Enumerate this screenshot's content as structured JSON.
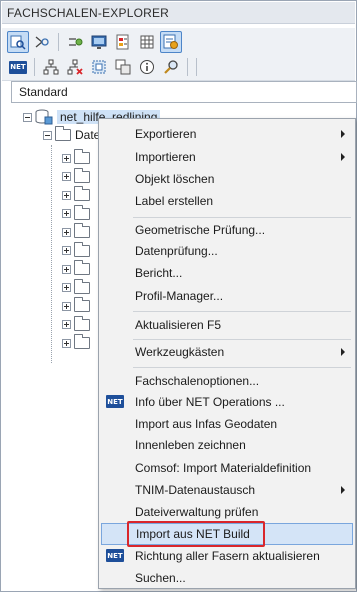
{
  "panel": {
    "title": "FACHSCHALEN-EXPLORER"
  },
  "toolbar": {
    "row1": [
      "display-icon",
      "navigate-icon",
      "settings-icon",
      "monitor-icon",
      "properties-icon",
      "grid-icon",
      "explorer-icon"
    ],
    "row2_badge": "NET",
    "row2": [
      "hierarchy-icon",
      "hierarchy-delete-icon",
      "select-icon",
      "copy-icon",
      "info-icon",
      "search-icon"
    ]
  },
  "filter": {
    "value": "Standard"
  },
  "tree": {
    "root": "net_hilfe_redlining",
    "child": "Date",
    "folder_rows": 11
  },
  "context_menu": {
    "items": [
      {
        "label": "Exportieren",
        "submenu": true
      },
      {
        "label": "Importieren",
        "submenu": true
      },
      {
        "label": "Objekt löschen"
      },
      {
        "label": "Label erstellen"
      },
      {
        "label": "Geometrische Prüfung..."
      },
      {
        "label": "Datenprüfung..."
      },
      {
        "label": "Bericht..."
      },
      {
        "label": "Profil-Manager..."
      },
      {
        "label": "Aktualisieren F5"
      },
      {
        "label": "Werkzeugkästen",
        "submenu": true
      },
      {
        "label": "Fachschalenoptionen..."
      },
      {
        "label": "Info über NET Operations ...",
        "icon": "NET"
      },
      {
        "label": "Import aus Infas Geodaten"
      },
      {
        "label": "Innenleben zeichnen"
      },
      {
        "label": "Comsof: Import Materialdefinition"
      },
      {
        "label": "TNIM-Datenaustausch",
        "submenu": true
      },
      {
        "label": "Dateiverwaltung prüfen"
      },
      {
        "label": "Import aus NET Build",
        "highlighted": true
      },
      {
        "label": "Richtung aller Fasern aktualisieren",
        "icon": "NET"
      },
      {
        "label": "Suchen..."
      }
    ],
    "highlight_color": "#d4e4f7",
    "annotation_color": "#d9262b"
  }
}
